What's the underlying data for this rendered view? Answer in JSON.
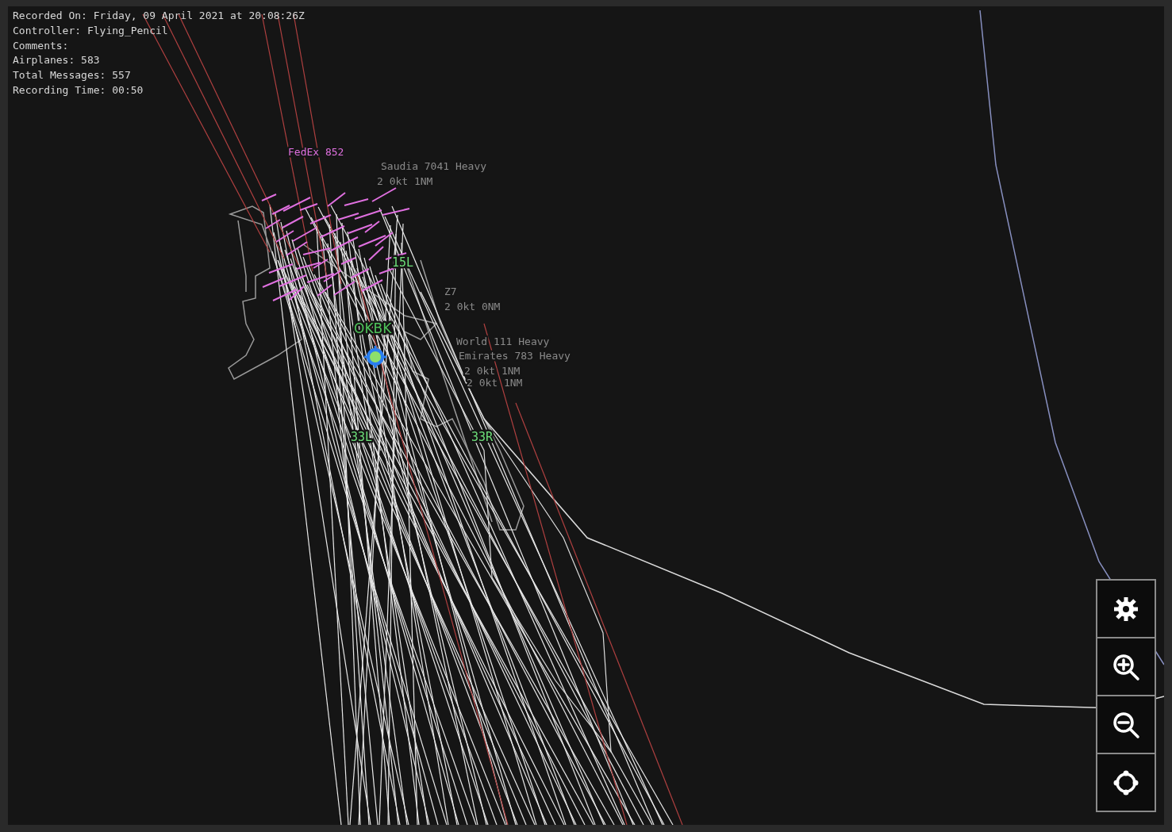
{
  "recording_info": [
    "Recorded On: Friday, 09 April 2021 at 20:08:26Z",
    "Controller: Flying_Pencil",
    "Comments:",
    "Airplanes: 583",
    "Total Messages: 557",
    "Recording Time: 00:50"
  ],
  "map": {
    "airport": "OKBK",
    "runway_labels": [
      "15L",
      "33L",
      "33R"
    ],
    "aircraft_labels": [
      {
        "text": "FedEx 852",
        "color": "#e070e0"
      },
      {
        "text": "Saudia 7041 Heavy",
        "color": "#8a8a8a"
      },
      {
        "text": "2 0kt 1NM",
        "color": "#8a8a8a"
      },
      {
        "text": "Z7",
        "color": "#8a8a8a"
      },
      {
        "text": "2 0kt 0NM",
        "color": "#8a8a8a"
      },
      {
        "text": "World 111 Heavy",
        "color": "#8a8a8a"
      },
      {
        "text": "Emirates 783 Heavy",
        "color": "#8a8a8a"
      },
      {
        "text": "2 0kt 1NM",
        "color": "#8a8a8a"
      },
      {
        "text": "2 0kt 1NM",
        "color": "#8a8a8a"
      }
    ]
  },
  "map_controls": [
    {
      "kind": "settings"
    },
    {
      "kind": "zoom_in"
    },
    {
      "kind": "zoom_out"
    },
    {
      "kind": "center"
    }
  ]
}
